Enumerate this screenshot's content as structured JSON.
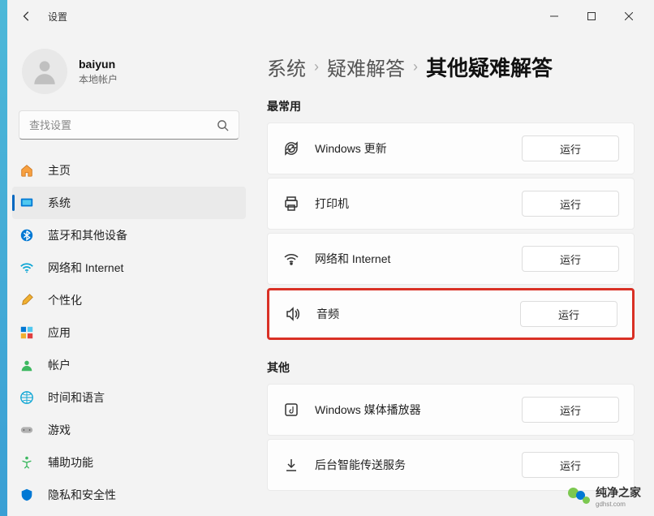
{
  "header": {
    "title": "设置"
  },
  "profile": {
    "username": "baiyun",
    "usertype": "本地帐户"
  },
  "search": {
    "placeholder": "查找设置"
  },
  "sidebar": {
    "items": [
      {
        "label": "主页"
      },
      {
        "label": "系统"
      },
      {
        "label": "蓝牙和其他设备"
      },
      {
        "label": "网络和 Internet"
      },
      {
        "label": "个性化"
      },
      {
        "label": "应用"
      },
      {
        "label": "帐户"
      },
      {
        "label": "时间和语言"
      },
      {
        "label": "游戏"
      },
      {
        "label": "辅助功能"
      },
      {
        "label": "隐私和安全性"
      }
    ]
  },
  "breadcrumb": {
    "l1": "系统",
    "l2": "疑难解答",
    "current": "其他疑难解答"
  },
  "sections": {
    "most_used_title": "最常用",
    "other_title": "其他"
  },
  "troubleshooters": {
    "most_used": [
      {
        "label": "Windows 更新",
        "run": "运行"
      },
      {
        "label": "打印机",
        "run": "运行"
      },
      {
        "label": "网络和 Internet",
        "run": "运行"
      },
      {
        "label": "音频",
        "run": "运行"
      }
    ],
    "other": [
      {
        "label": "Windows 媒体播放器",
        "run": "运行"
      },
      {
        "label": "后台智能传送服务",
        "run": "运行"
      }
    ]
  },
  "watermark": {
    "text": "纯净之家",
    "sub": "gdhst.com"
  }
}
